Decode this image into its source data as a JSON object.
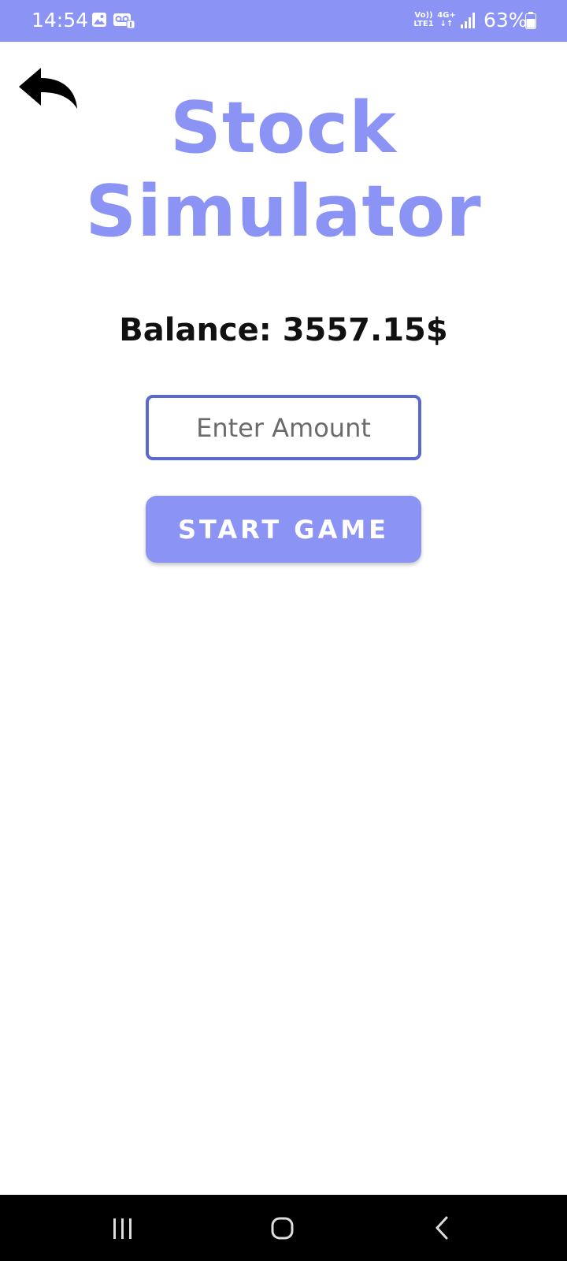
{
  "status_bar": {
    "time": "14:54",
    "volte_line1": "Vo))",
    "volte_line2": "LTE1",
    "network_line1": "4G+",
    "network_line2": "↓↑",
    "battery": "63%",
    "icons": [
      "gallery-icon",
      "voicemail-icon",
      "volte-icon",
      "network-4g-icon",
      "signal-icon",
      "battery-icon"
    ],
    "background_color": "#8b94f5"
  },
  "header": {
    "back_icon": "back-arrow-icon"
  },
  "title": {
    "line1": "Stock",
    "line2": "Simulator",
    "color": "#8b94f5"
  },
  "balance": {
    "text": "Balance: 3557.15$"
  },
  "amount_input": {
    "placeholder": "Enter Amount",
    "value": "",
    "border_color": "#5a68cf"
  },
  "start_button": {
    "label": "START GAME",
    "color": "#8b94f5"
  },
  "nav_bar": {
    "icons": [
      "recents-icon",
      "home-icon",
      "back-icon"
    ]
  }
}
